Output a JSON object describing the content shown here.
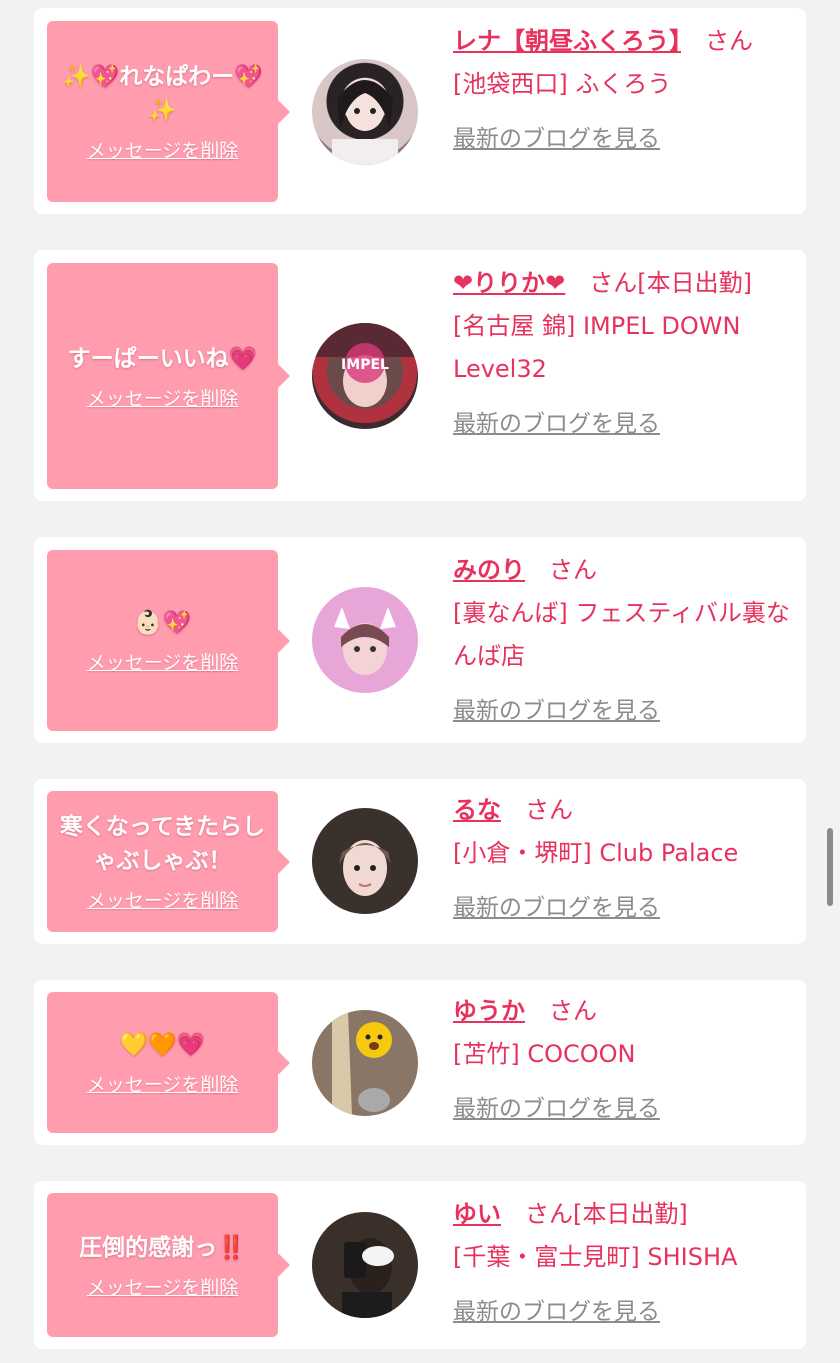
{
  "delete_label": "メッセージを削除",
  "blog_label": "最新のブログを見る",
  "colors": {
    "accent": "#e7325d",
    "bubble": "#ff9daf",
    "muted": "#8c8c8c"
  },
  "items": [
    {
      "message": "✨💖れなぱわー💖✨",
      "name": "レナ【朝昼ふくろう】",
      "suffix": "さん",
      "shop": "[池袋西口] ふくろう"
    },
    {
      "message": "すーぱーいいね💗",
      "name": "❤︎りりか❤︎",
      "suffix": "さん[本日出勤]",
      "shop": "[名古屋 錦] IMPEL DOWN Level32"
    },
    {
      "message": "👶🏻💖",
      "name": "みのり",
      "suffix": "さん",
      "shop": "[裏なんば] フェスティバル裏なんば店"
    },
    {
      "message": "寒くなってきたらしゃぶしゃぶ！",
      "name": "るな",
      "suffix": "さん",
      "shop": "[小倉・堺町] Club Palace"
    },
    {
      "message": "💛🧡💗",
      "name": "ゆうか",
      "suffix": "さん",
      "shop": "[苫竹] COCOON"
    },
    {
      "message": "圧倒的感謝っ‼️",
      "name": "ゆい",
      "suffix": "さん[本日出勤]",
      "shop": "[千葉・富士見町] SHISHA"
    }
  ]
}
